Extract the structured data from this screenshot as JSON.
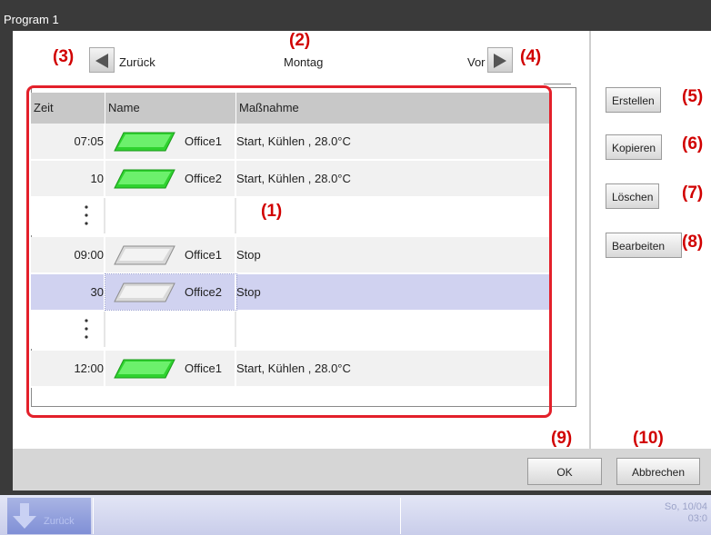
{
  "window": {
    "title": "Program 1"
  },
  "nav": {
    "back_label": "Zurück",
    "day_label": "Montag",
    "forward_label": "Vor"
  },
  "callouts": {
    "c1": "(1)",
    "c2": "(2)",
    "c3": "(3)",
    "c4": "(4)",
    "c5": "(5)",
    "c6": "(6)",
    "c7": "(7)",
    "c8": "(8)",
    "c9": "(9)",
    "c10": "(10)"
  },
  "list": {
    "columns": [
      "Zeit",
      "Name",
      "Maßnahme"
    ],
    "rows": [
      {
        "time": "07:05",
        "name": "Office1",
        "action": "Start, Kühlen , 28.0°C",
        "state": "on"
      },
      {
        "time": "10",
        "name": "Office2",
        "action": "Start, Kühlen , 28.0°C",
        "state": "on"
      },
      {
        "time": "09:00",
        "name": "Office1",
        "action": "Stop",
        "state": "off"
      },
      {
        "time": "30",
        "name": "Office2",
        "action": "Stop",
        "state": "off"
      },
      {
        "time": "12:00",
        "name": "Office1",
        "action": "Start, Kühlen , 28.0°C",
        "state": "on"
      }
    ]
  },
  "side_buttons": {
    "create": "Erstellen",
    "copy": "Kopieren",
    "delete": "Löschen",
    "edit": "Bearbeiten"
  },
  "footer": {
    "ok": "OK",
    "cancel": "Abbrechen"
  },
  "taskbar": {
    "back": "Zurück",
    "date": "So, 10/04",
    "time": "03:0"
  },
  "colors": {
    "callout": "#e3202a",
    "selected_row": "#d0d2f0",
    "on_icon": "#2fd22f",
    "off_icon": "#d9d9d9"
  }
}
